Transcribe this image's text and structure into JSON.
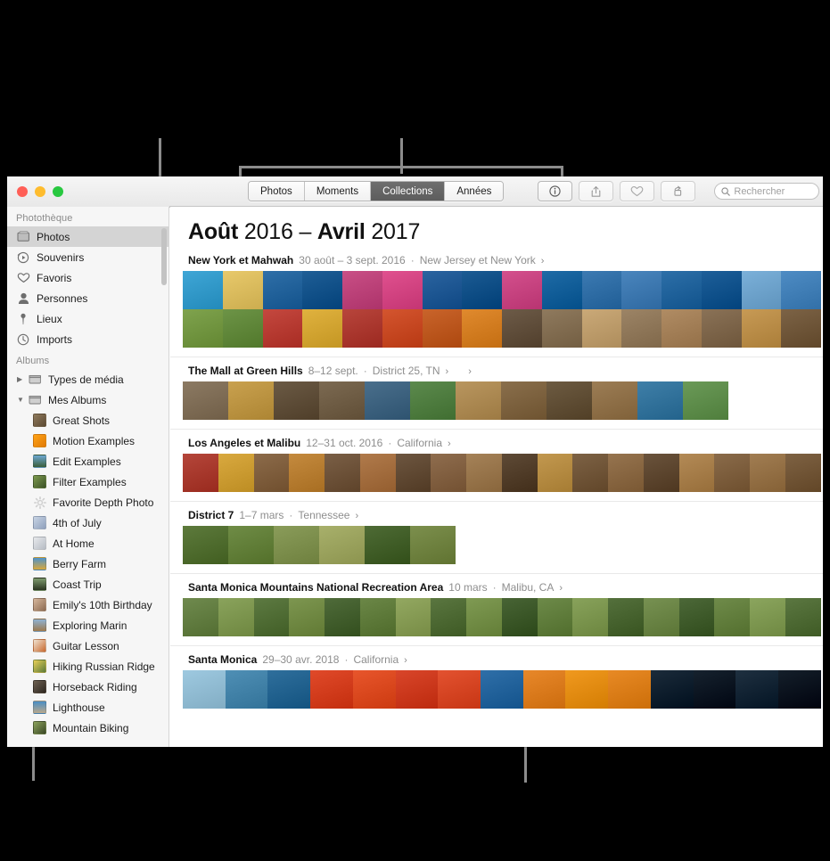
{
  "window": {
    "traffic_lights": [
      "close",
      "minimize",
      "zoom"
    ],
    "colors": {
      "close": "#ff5f57",
      "minimize": "#febc2e",
      "zoom": "#28c840",
      "selection": "#d4d4d4",
      "active_segment": "#6e6e6e"
    }
  },
  "toolbar": {
    "segments": [
      {
        "label": "Photos",
        "active": false
      },
      {
        "label": "Moments",
        "active": false
      },
      {
        "label": "Collections",
        "active": true
      },
      {
        "label": "Années",
        "active": false
      }
    ],
    "buttons": [
      {
        "name": "info-button",
        "icon": "info-icon"
      },
      {
        "name": "share-button",
        "icon": "share-icon"
      },
      {
        "name": "favorite-button",
        "icon": "heart-icon"
      },
      {
        "name": "rotate-button",
        "icon": "rotate-icon"
      }
    ],
    "search": {
      "placeholder": "Rechercher",
      "value": "",
      "icon": "search-icon"
    }
  },
  "sidebar": {
    "sections": [
      {
        "title": "Photothèque",
        "items": [
          {
            "label": "Photos",
            "icon": "photos-icon",
            "selected": true
          },
          {
            "label": "Souvenirs",
            "icon": "memories-icon",
            "selected": false
          },
          {
            "label": "Favoris",
            "icon": "heart-icon",
            "selected": false
          },
          {
            "label": "Personnes",
            "icon": "person-icon",
            "selected": false
          },
          {
            "label": "Lieux",
            "icon": "pin-icon",
            "selected": false
          },
          {
            "label": "Imports",
            "icon": "clock-icon",
            "selected": false
          }
        ]
      },
      {
        "title": "Albums",
        "items": [
          {
            "label": "Types de média",
            "icon": "folder-icon",
            "disclosure": "collapsed",
            "selected": false
          },
          {
            "label": "Mes Albums",
            "icon": "folder-icon",
            "disclosure": "expanded",
            "selected": false
          },
          {
            "label": "Great Shots",
            "icon": "album-thumb",
            "color": "#7b6a52",
            "indent": 2
          },
          {
            "label": "Motion Examples",
            "icon": "album-thumb",
            "color": "#f2930d",
            "indent": 2
          },
          {
            "label": "Edit Examples",
            "icon": "album-thumb",
            "color": "#4a7fa8",
            "indent": 2
          },
          {
            "label": "Filter Examples",
            "icon": "album-thumb",
            "color": "#5d7a3c",
            "indent": 2
          },
          {
            "label": "Favorite Depth Photo",
            "icon": "gear-icon",
            "color": "#d8d8d8",
            "indent": 2
          },
          {
            "label": "4th of July",
            "icon": "album-thumb",
            "color": "#a2b6cf",
            "indent": 2
          },
          {
            "label": "At Home",
            "icon": "album-thumb",
            "color": "#cfd3d8",
            "indent": 2
          },
          {
            "label": "Berry Farm",
            "icon": "album-thumb",
            "color": "#3e7cb1",
            "indent": 2
          },
          {
            "label": "Coast Trip",
            "icon": "album-thumb",
            "color": "#3d4a2e",
            "indent": 2
          },
          {
            "label": "Emily's 10th Birthday",
            "icon": "album-thumb",
            "color": "#b59a86",
            "indent": 2
          },
          {
            "label": "Exploring Marin",
            "icon": "album-thumb",
            "color": "#6e8fad",
            "indent": 2
          },
          {
            "label": "Guitar Lesson",
            "icon": "album-thumb",
            "color": "#c8692f",
            "indent": 2
          },
          {
            "label": "Hiking Russian Ridge",
            "icon": "album-thumb",
            "color": "#d9bc4c",
            "indent": 2
          },
          {
            "label": "Horseback Riding",
            "icon": "album-thumb",
            "color": "#4e4438",
            "indent": 2
          },
          {
            "label": "Lighthouse",
            "icon": "album-thumb",
            "color": "#3c79b5",
            "indent": 2
          },
          {
            "label": "Mountain Biking",
            "icon": "album-thumb",
            "color": "#5c6b3d",
            "indent": 2
          }
        ]
      }
    ]
  },
  "main": {
    "title": {
      "month_start": "Août",
      "year_start": "2016",
      "dash": "–",
      "month_end": "Avril",
      "year_end": "2017"
    },
    "moments": [
      {
        "title": "New York et Mahwah",
        "date": "30 août – 3 sept. 2016",
        "place": "New Jersey et New York",
        "chevron": "›",
        "extra_chevron": null,
        "rows": [
          [
            "#3fa6d6",
            "#e8c96b",
            "#2f6fa8",
            "#1f5e96",
            "#c94f86",
            "#e0518f",
            "#2b64a0",
            "#1c5b93",
            "#d4508d",
            "#1f6ba6",
            "#3c7ab2",
            "#4a85bd",
            "#2d6fa8",
            "#1e5f99",
            "#7bb0d9",
            "#4e8cc4"
          ],
          [
            "#7fa34e",
            "#6d9447",
            "#c4483f",
            "#e0b23f",
            "#b8453c",
            "#d4552f",
            "#c9642b",
            "#e08a2e",
            "#6d5b48",
            "#8f7a5e",
            "#caa978",
            "#9c8466",
            "#b08c64",
            "#8a7257",
            "#c79a55",
            "#7c6346"
          ]
        ]
      },
      {
        "title": "The Mall at Green Hills",
        "date": "8–12 sept.",
        "place": "District 25, TN",
        "chevron": "›",
        "extra_chevron": "›",
        "rows": [
          [
            "#8c7a63",
            "#c9a14f",
            "#6b5a45",
            "#7c6a52",
            "#4a6f8c",
            "#5c8a4d"
          ],
          [
            "#b9965f",
            "#8a6f4c",
            "#6d5b42",
            "#9c7d55",
            "#3f7fa8",
            "#6b9a58"
          ]
        ]
      },
      {
        "title": "Los Angeles et Malibu",
        "date": "12–31 oct. 2016",
        "place": "California",
        "chevron": "›",
        "extra_chevron": null,
        "rows": [
          [
            "#b5463a",
            "#d9a93f",
            "#8c6b4a",
            "#c48a3e",
            "#7a5f46",
            "#b07a4b",
            "#6d5640",
            "#8f6d4e",
            "#a58258",
            "#5e4a36",
            "#c2984f",
            "#7d6245",
            "#96744f",
            "#6a533c",
            "#b38a56",
            "#8a6b4a",
            "#a17d52",
            "#7e6243"
          ]
        ]
      },
      {
        "title": "District 7",
        "date": "1–7 mars",
        "place": "Tennessee",
        "chevron": "›",
        "extra_chevron": null,
        "rows": [
          [
            "#5d7a3c",
            "#6f8c46",
            "#8a9c5a",
            "#a8b06b",
            "#4e6b35",
            "#7c8f4d"
          ]
        ]
      },
      {
        "title": "Santa Monica Mountains National Recreation Area",
        "date": "10 mars",
        "place": "Malibu, CA",
        "chevron": "›",
        "extra_chevron": null,
        "rows": [
          [
            "#6f8a4e",
            "#8aa35c",
            "#5d7a42",
            "#7d9650",
            "#4f6b3a",
            "#6b8747",
            "#93a861",
            "#5a7640",
            "#7f9a53",
            "#486435",
            "#6d8a49",
            "#88a25b",
            "#54703c",
            "#779152",
            "#4c6838",
            "#6f8b4a",
            "#8ba55e",
            "#5b7741"
          ]
        ]
      },
      {
        "title": "Santa Monica",
        "date": "29–30 avr. 2018",
        "place": "California",
        "chevron": "›",
        "extra_chevron": null,
        "rows": [
          [
            "#9ec9e0",
            "#4f8fb5",
            "#2f6f9c",
            "#e04a2a",
            "#e8562c",
            "#d9462a",
            "#e35230",
            "#2f6fa8",
            "#e8882a",
            "#f0991f",
            "#e88a25",
            "#1b2b3a",
            "#16222e",
            "#1f3040",
            "#141f2a"
          ]
        ]
      }
    ]
  }
}
